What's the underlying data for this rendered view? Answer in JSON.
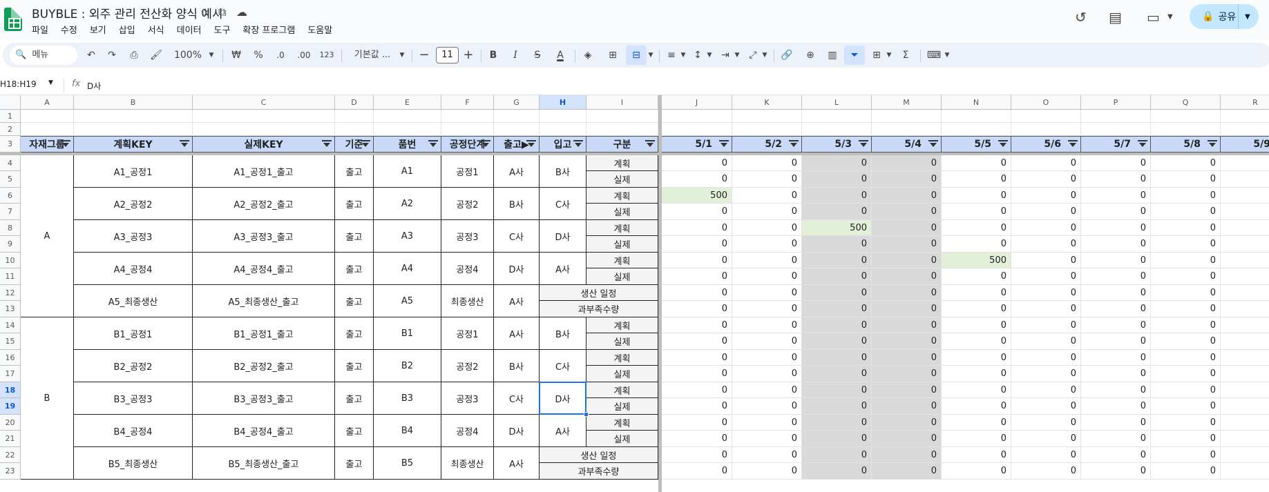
{
  "app": {
    "title": "BUYBLE : 외주 관리 전산화 양식 예시",
    "menu": [
      "파일",
      "수정",
      "보기",
      "삽입",
      "서식",
      "데이터",
      "도구",
      "확장 프로그램",
      "도움말"
    ],
    "share_label": "공유"
  },
  "toolbar": {
    "search_label": "메뉴",
    "zoom": "100%",
    "currency": "₩",
    "percent": "%",
    "decimal_decrease": ".0",
    "decimal_increase": ".00",
    "number_format": "123",
    "font": "기본값 ...",
    "font_size": "11",
    "bold": "B",
    "italic": "I",
    "strike": "S",
    "text_color": "A",
    "sum": "Σ"
  },
  "formula_bar": {
    "name_box": "H18:H19",
    "fx": "fx",
    "value": "D사"
  },
  "columns": [
    "A",
    "B",
    "C",
    "D",
    "E",
    "F",
    "G",
    "H",
    "I",
    "J",
    "K",
    "L",
    "M",
    "N",
    "O",
    "P",
    "Q",
    "R"
  ],
  "rows": [
    "1",
    "2",
    "3",
    "4",
    "5",
    "6",
    "7",
    "8",
    "9",
    "10",
    "11",
    "12",
    "13",
    "14",
    "15",
    "16",
    "17",
    "18",
    "19",
    "20",
    "21",
    "22",
    "23"
  ],
  "header": [
    "자재그룹",
    "계획KEY",
    "실제KEY",
    "기준",
    "품번",
    "공정단계",
    "출고▶",
    "입고",
    "구분"
  ],
  "dates": [
    "5/1",
    "5/2",
    "5/3",
    "5/4",
    "5/5",
    "5/6",
    "5/7",
    "5/8",
    "5/9"
  ],
  "groups": [
    {
      "name": "A",
      "items": [
        {
          "plan": "A1_공정1",
          "actual": "A1_공정1_출고",
          "base": "출고",
          "part": "A1",
          "stage": "공정1",
          "out": "A사",
          "in": "B사",
          "types": [
            "계획",
            "실제"
          ]
        },
        {
          "plan": "A2_공정2",
          "actual": "A2_공정2_출고",
          "base": "출고",
          "part": "A2",
          "stage": "공정2",
          "out": "B사",
          "in": "C사",
          "types": [
            "계획",
            "실제"
          ]
        },
        {
          "plan": "A3_공정3",
          "actual": "A3_공정3_출고",
          "base": "출고",
          "part": "A3",
          "stage": "공정3",
          "out": "C사",
          "in": "D사",
          "types": [
            "계획",
            "실제"
          ]
        },
        {
          "plan": "A4_공정4",
          "actual": "A4_공정4_출고",
          "base": "출고",
          "part": "A4",
          "stage": "공정4",
          "out": "D사",
          "in": "A사",
          "types": [
            "계획",
            "실제"
          ]
        },
        {
          "plan": "A5_최종생산",
          "actual": "A5_최종생산_출고",
          "base": "출고",
          "part": "A5",
          "stage": "최종생산",
          "out": "A사",
          "in": "",
          "types": [
            "생산 일정",
            "과부족수량"
          ]
        }
      ]
    },
    {
      "name": "B",
      "items": [
        {
          "plan": "B1_공정1",
          "actual": "B1_공정1_출고",
          "base": "출고",
          "part": "B1",
          "stage": "공정1",
          "out": "A사",
          "in": "B사",
          "types": [
            "계획",
            "실제"
          ]
        },
        {
          "plan": "B2_공정2",
          "actual": "B2_공정2_출고",
          "base": "출고",
          "part": "B2",
          "stage": "공정2",
          "out": "B사",
          "in": "C사",
          "types": [
            "계획",
            "실제"
          ]
        },
        {
          "plan": "B3_공정3",
          "actual": "B3_공정3_출고",
          "base": "출고",
          "part": "B3",
          "stage": "공정3",
          "out": "C사",
          "in": "D사",
          "types": [
            "계획",
            "실제"
          ]
        },
        {
          "plan": "B4_공정4",
          "actual": "B4_공정4_출고",
          "base": "출고",
          "part": "B4",
          "stage": "공정4",
          "out": "D사",
          "in": "A사",
          "types": [
            "계획",
            "실제"
          ]
        },
        {
          "plan": "B5_최종생산",
          "actual": "B5_최종생산_출고",
          "base": "출고",
          "part": "B5",
          "stage": "최종생산",
          "out": "A사",
          "in": "",
          "types": [
            "생산 일정",
            "과부족수량"
          ]
        }
      ]
    }
  ],
  "values": [
    [
      "0",
      "0",
      "0",
      "0",
      "0",
      "0",
      "0",
      "0"
    ],
    [
      "0",
      "0",
      "0",
      "0",
      "0",
      "0",
      "0",
      "0"
    ],
    [
      "500",
      "0",
      "0",
      "0",
      "0",
      "0",
      "0",
      "0"
    ],
    [
      "0",
      "0",
      "0",
      "0",
      "0",
      "0",
      "0",
      "0"
    ],
    [
      "0",
      "0",
      "500",
      "0",
      "0",
      "0",
      "0",
      "0"
    ],
    [
      "0",
      "0",
      "0",
      "0",
      "0",
      "0",
      "0",
      "0"
    ],
    [
      "0",
      "0",
      "0",
      "0",
      "500",
      "0",
      "0",
      "0"
    ],
    [
      "0",
      "0",
      "0",
      "0",
      "0",
      "0",
      "0",
      "0"
    ],
    [
      "0",
      "0",
      "0",
      "0",
      "0",
      "0",
      "0",
      "0"
    ],
    [
      "0",
      "0",
      "0",
      "0",
      "0",
      "0",
      "0",
      "0"
    ],
    [
      "0",
      "0",
      "0",
      "0",
      "0",
      "0",
      "0",
      "0"
    ],
    [
      "0",
      "0",
      "0",
      "0",
      "0",
      "0",
      "0",
      "0"
    ],
    [
      "0",
      "0",
      "0",
      "0",
      "0",
      "0",
      "0",
      "0"
    ],
    [
      "0",
      "0",
      "0",
      "0",
      "0",
      "0",
      "0",
      "0"
    ],
    [
      "0",
      "0",
      "0",
      "0",
      "0",
      "0",
      "0",
      "0"
    ],
    [
      "0",
      "0",
      "0",
      "0",
      "0",
      "0",
      "0",
      "0"
    ],
    [
      "0",
      "0",
      "0",
      "0",
      "0",
      "0",
      "0",
      "0"
    ],
    [
      "0",
      "0",
      "0",
      "0",
      "0",
      "0",
      "0",
      "0"
    ],
    [
      "0",
      "0",
      "0",
      "0",
      "0",
      "0",
      "0",
      "0"
    ],
    [
      "0",
      "0",
      "0",
      "0",
      "0",
      "0",
      "0",
      "0"
    ]
  ],
  "colors": {
    "accent": "#1a73e8",
    "header_fill": "#c9daf8",
    "weekend_fill": "#d9d9d9",
    "highlight_fill": "#e2efd9"
  }
}
